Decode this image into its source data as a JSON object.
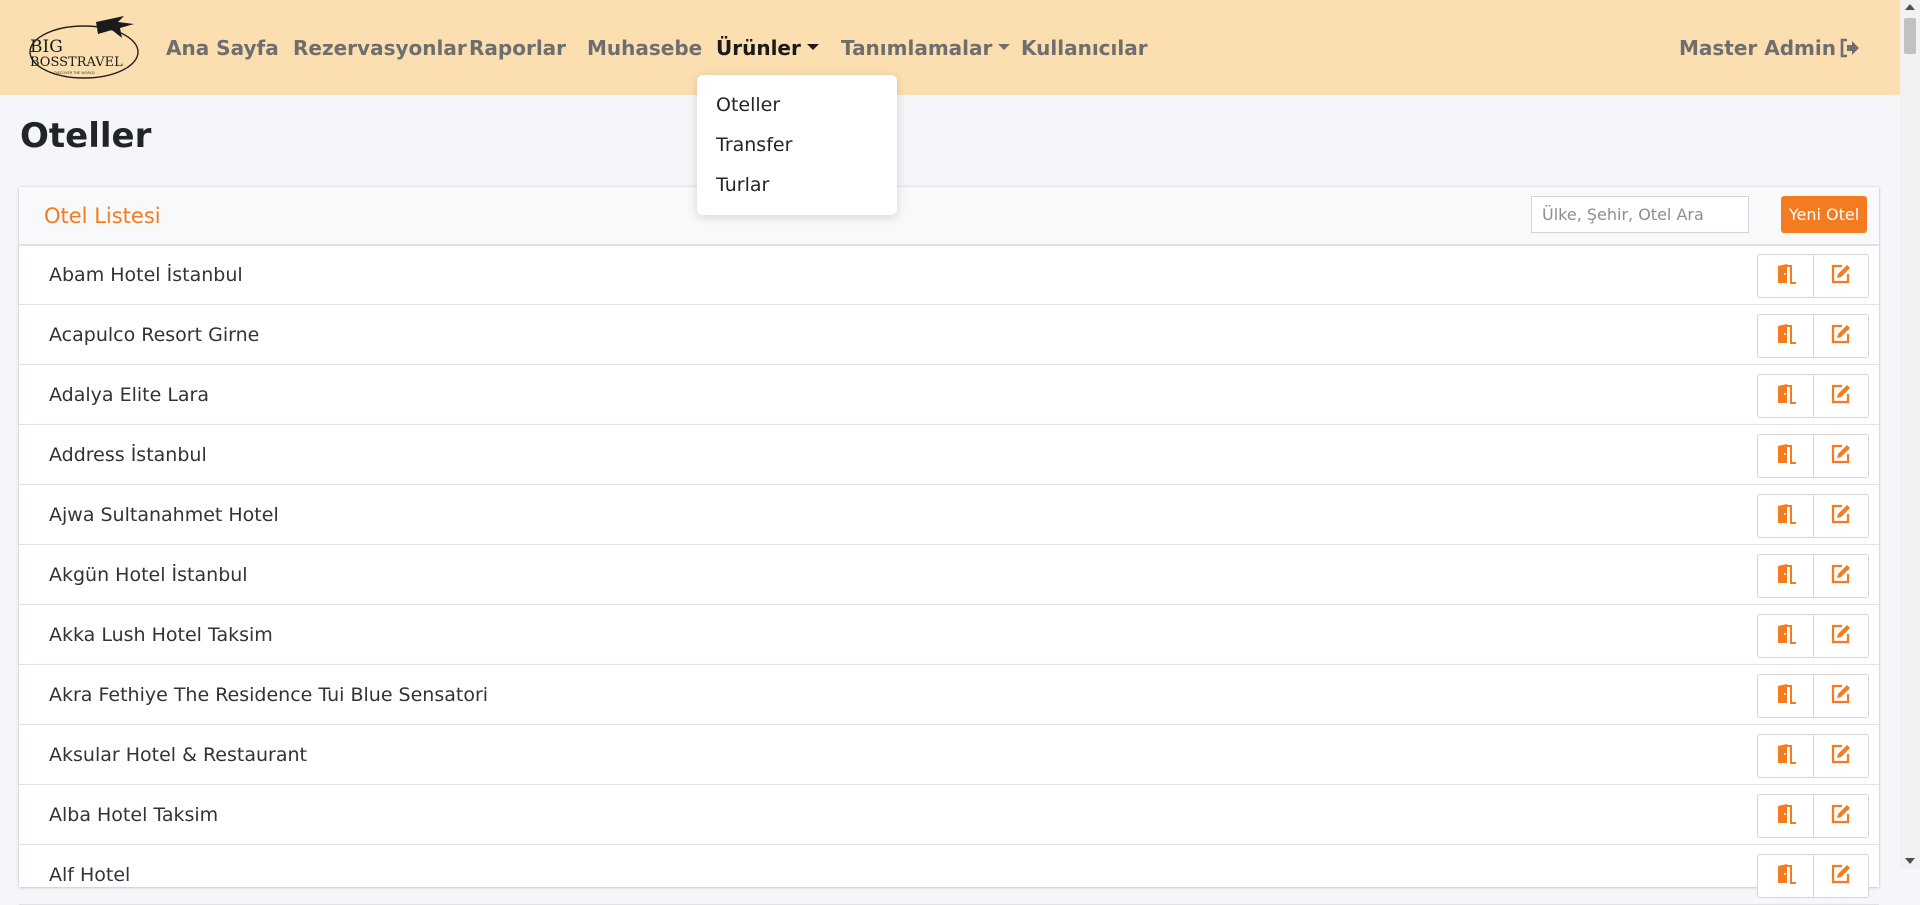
{
  "navbar": {
    "logo_text_top": "BIG",
    "logo_text_main": "BOSSTRAVEL",
    "logo_tagline": "DISCOVER THE WORLD",
    "items": [
      {
        "label": "Ana Sayfa"
      },
      {
        "label": "Rezervasyonlar"
      },
      {
        "label": "Raporlar"
      },
      {
        "label": "Muhasebe"
      },
      {
        "label": "Ürünler"
      },
      {
        "label": "Tanımlamalar"
      },
      {
        "label": "Kullanıcılar"
      }
    ],
    "user": "Master Admin",
    "accent": "#fcdfb1"
  },
  "dropdown": {
    "items": [
      {
        "label": "Oteller"
      },
      {
        "label": "Transfer"
      },
      {
        "label": "Turlar"
      }
    ]
  },
  "page": {
    "title": "Oteller"
  },
  "card": {
    "title": "Otel Listesi",
    "search_placeholder": "Ülke, Şehir, Otel Ara",
    "new_button": "Yeni Otel",
    "accent": "#f47b20",
    "rows": [
      {
        "name": "Abam Hotel İstanbul"
      },
      {
        "name": "Acapulco Resort Girne"
      },
      {
        "name": "Adalya Elite Lara"
      },
      {
        "name": "Address İstanbul"
      },
      {
        "name": "Ajwa Sultanahmet Hotel"
      },
      {
        "name": "Akgün Hotel İstanbul"
      },
      {
        "name": "Akka Lush Hotel Taksim"
      },
      {
        "name": "Akra Fethiye The Residence Tui Blue Sensatori"
      },
      {
        "name": "Aksular Hotel & Restaurant"
      },
      {
        "name": "Alba Hotel Taksim"
      },
      {
        "name": "Alf Hotel"
      }
    ],
    "row_icons": [
      "door-icon",
      "edit-icon"
    ]
  }
}
